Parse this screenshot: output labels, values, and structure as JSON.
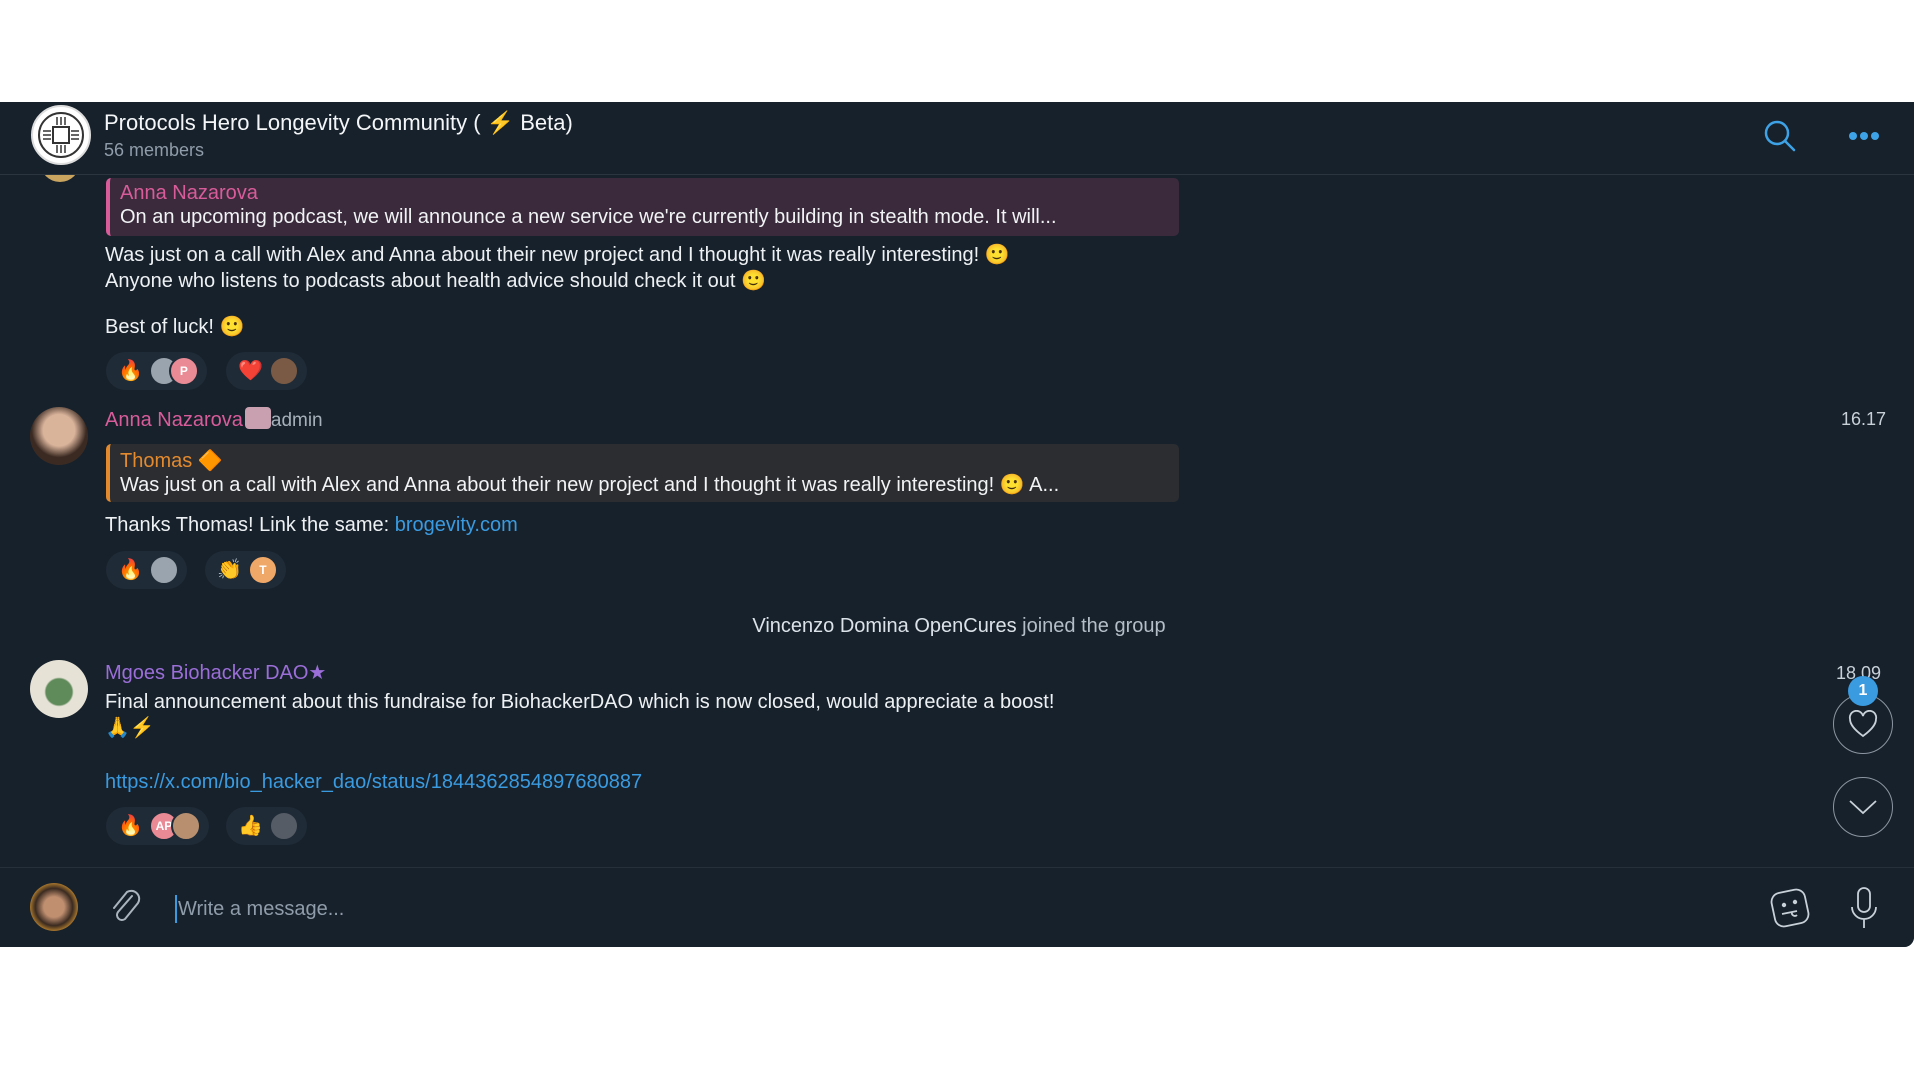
{
  "header": {
    "title": "Protocols Hero Longevity Community ( ⚡ Beta)",
    "members": "56 members",
    "icons": [
      "search-icon",
      "more-icon"
    ],
    "accent": "#3ea3e6"
  },
  "messages": [
    {
      "sender": "",
      "reply_to": {
        "name": "Anna Nazarova",
        "text": "On an upcoming podcast, we will announce a new service we're currently building in stealth mode.  It will..."
      },
      "lines": [
        "Was just on a call with Alex and Anna about their new project and I thought it was really interesting! 🙂",
        "Anyone who listens to podcasts about health advice should check it out 🙂",
        "Best of luck! 🙂"
      ],
      "reactions": [
        {
          "emoji": "🔥",
          "users": [
            "photo",
            "P"
          ]
        },
        {
          "emoji": "❤️",
          "users": [
            "photo"
          ]
        }
      ]
    },
    {
      "sender": "Anna Nazarova",
      "badge": "admin",
      "time": "16.17",
      "sender_color": "#d95c9a",
      "reply_to": {
        "name": "Thomas 🔶",
        "text": "Was just on a call with Alex and Anna about their new project and I thought it was really interesting! 🙂  A..."
      },
      "text": "Thanks Thomas! Link the same: ",
      "link": "brogevity.com",
      "reactions": [
        {
          "emoji": "🔥",
          "users": [
            "photo"
          ]
        },
        {
          "emoji": "👏",
          "users": [
            "T"
          ]
        }
      ]
    },
    {
      "sender": "Mgoes Biohacker DAO",
      "sender_suffix": "★",
      "time": "18.09",
      "sender_color": "#9b6ed8",
      "text": "Final announcement about this fundraise for BiohackerDAO which is now closed, would appreciate a boost!",
      "emojis": "🙏⚡",
      "link": "https://x.com/bio_hacker_dao/status/1844362854897680887",
      "reactions": [
        {
          "emoji": "🔥",
          "users": [
            "AP",
            "photo"
          ]
        },
        {
          "emoji": "👍",
          "users": [
            "photo"
          ]
        }
      ]
    }
  ],
  "service": {
    "name": "Vincenzo Domina OpenCures",
    "action": " joined the group"
  },
  "floating": {
    "reactions_badge": "1"
  },
  "input": {
    "placeholder": "Write a message..."
  }
}
